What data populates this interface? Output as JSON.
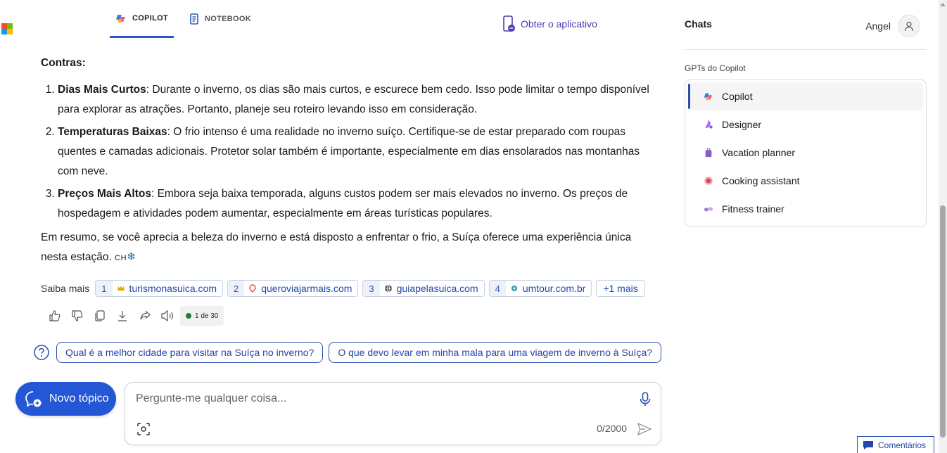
{
  "brand": {
    "logo_colors": [
      "#f25022",
      "#7fba00",
      "#00a4ef",
      "#ffb900"
    ]
  },
  "nav": {
    "tabs": [
      {
        "label": "COPILOT",
        "icon": "copilot-icon",
        "active": true
      },
      {
        "label": "NOTEBOOK",
        "icon": "notebook-icon",
        "active": false
      }
    ],
    "get_app": "Obter o aplicativo"
  },
  "answer": {
    "heading": "Contras:",
    "items": [
      {
        "title": "Dias Mais Curtos",
        "text": ": Durante o inverno, os dias são mais curtos, e escurece bem cedo. Isso pode limitar o tempo disponível para explorar as atrações. Portanto, planeje seu roteiro levando isso em consideração."
      },
      {
        "title": "Temperaturas Baixas",
        "text": ": O frio intenso é uma realidade no inverno suíço. Certifique-se de estar preparado com roupas quentes e camadas adicionais. Protetor solar também é importante, especialmente em dias ensolarados nas montanhas com neve."
      },
      {
        "title": "Preços Mais Altos",
        "text": ": Embora seja baixa temporada, alguns custos podem ser mais elevados no inverno. Os preços de hospedagem e atividades podem aumentar, especialmente em áreas turísticas populares."
      }
    ],
    "summary": "Em resumo, se você aprecia a beleza do inverno e está disposto a enfrentar o frio, a Suíça oferece uma experiência única nesta estação.",
    "summary_flag": "CH",
    "summary_emoji": "❄"
  },
  "learn_more": {
    "label": "Saiba mais",
    "sources": [
      {
        "num": "1",
        "site": "turismonasuica.com",
        "icon": "crown-icon"
      },
      {
        "num": "2",
        "site": "queroviajarmais.com",
        "icon": "map-pin-icon"
      },
      {
        "num": "3",
        "site": "guiapelasuica.com",
        "icon": "globe-icon"
      },
      {
        "num": "4",
        "site": "umtour.com.br",
        "icon": "site-icon"
      }
    ],
    "more": "+1 mais"
  },
  "response_counter": "1 de 30",
  "suggestions": [
    "Qual é a melhor cidade para visitar na Suíça no inverno?",
    "O que devo levar em minha mala para uma viagem de inverno à Suíça?"
  ],
  "new_topic": "Novo tópico",
  "composer": {
    "placeholder": "Pergunte-me qualquer coisa...",
    "char_count": "0/2000"
  },
  "sidebar": {
    "title": "Chats",
    "user": "Angel",
    "gpts_label": "GPTs do Copilot",
    "gpts": [
      {
        "label": "Copilot",
        "icon": "copilot-icon",
        "active": true
      },
      {
        "label": "Designer",
        "icon": "designer-icon",
        "active": false
      },
      {
        "label": "Vacation planner",
        "icon": "suitcase-icon",
        "active": false
      },
      {
        "label": "Cooking assistant",
        "icon": "cooking-icon",
        "active": false
      },
      {
        "label": "Fitness trainer",
        "icon": "dumbbell-icon",
        "active": false
      }
    ]
  },
  "feedback": "Comentários",
  "colors": {
    "accent": "#2457d6",
    "link": "#2148a8",
    "purple": "#4d3ab0"
  }
}
